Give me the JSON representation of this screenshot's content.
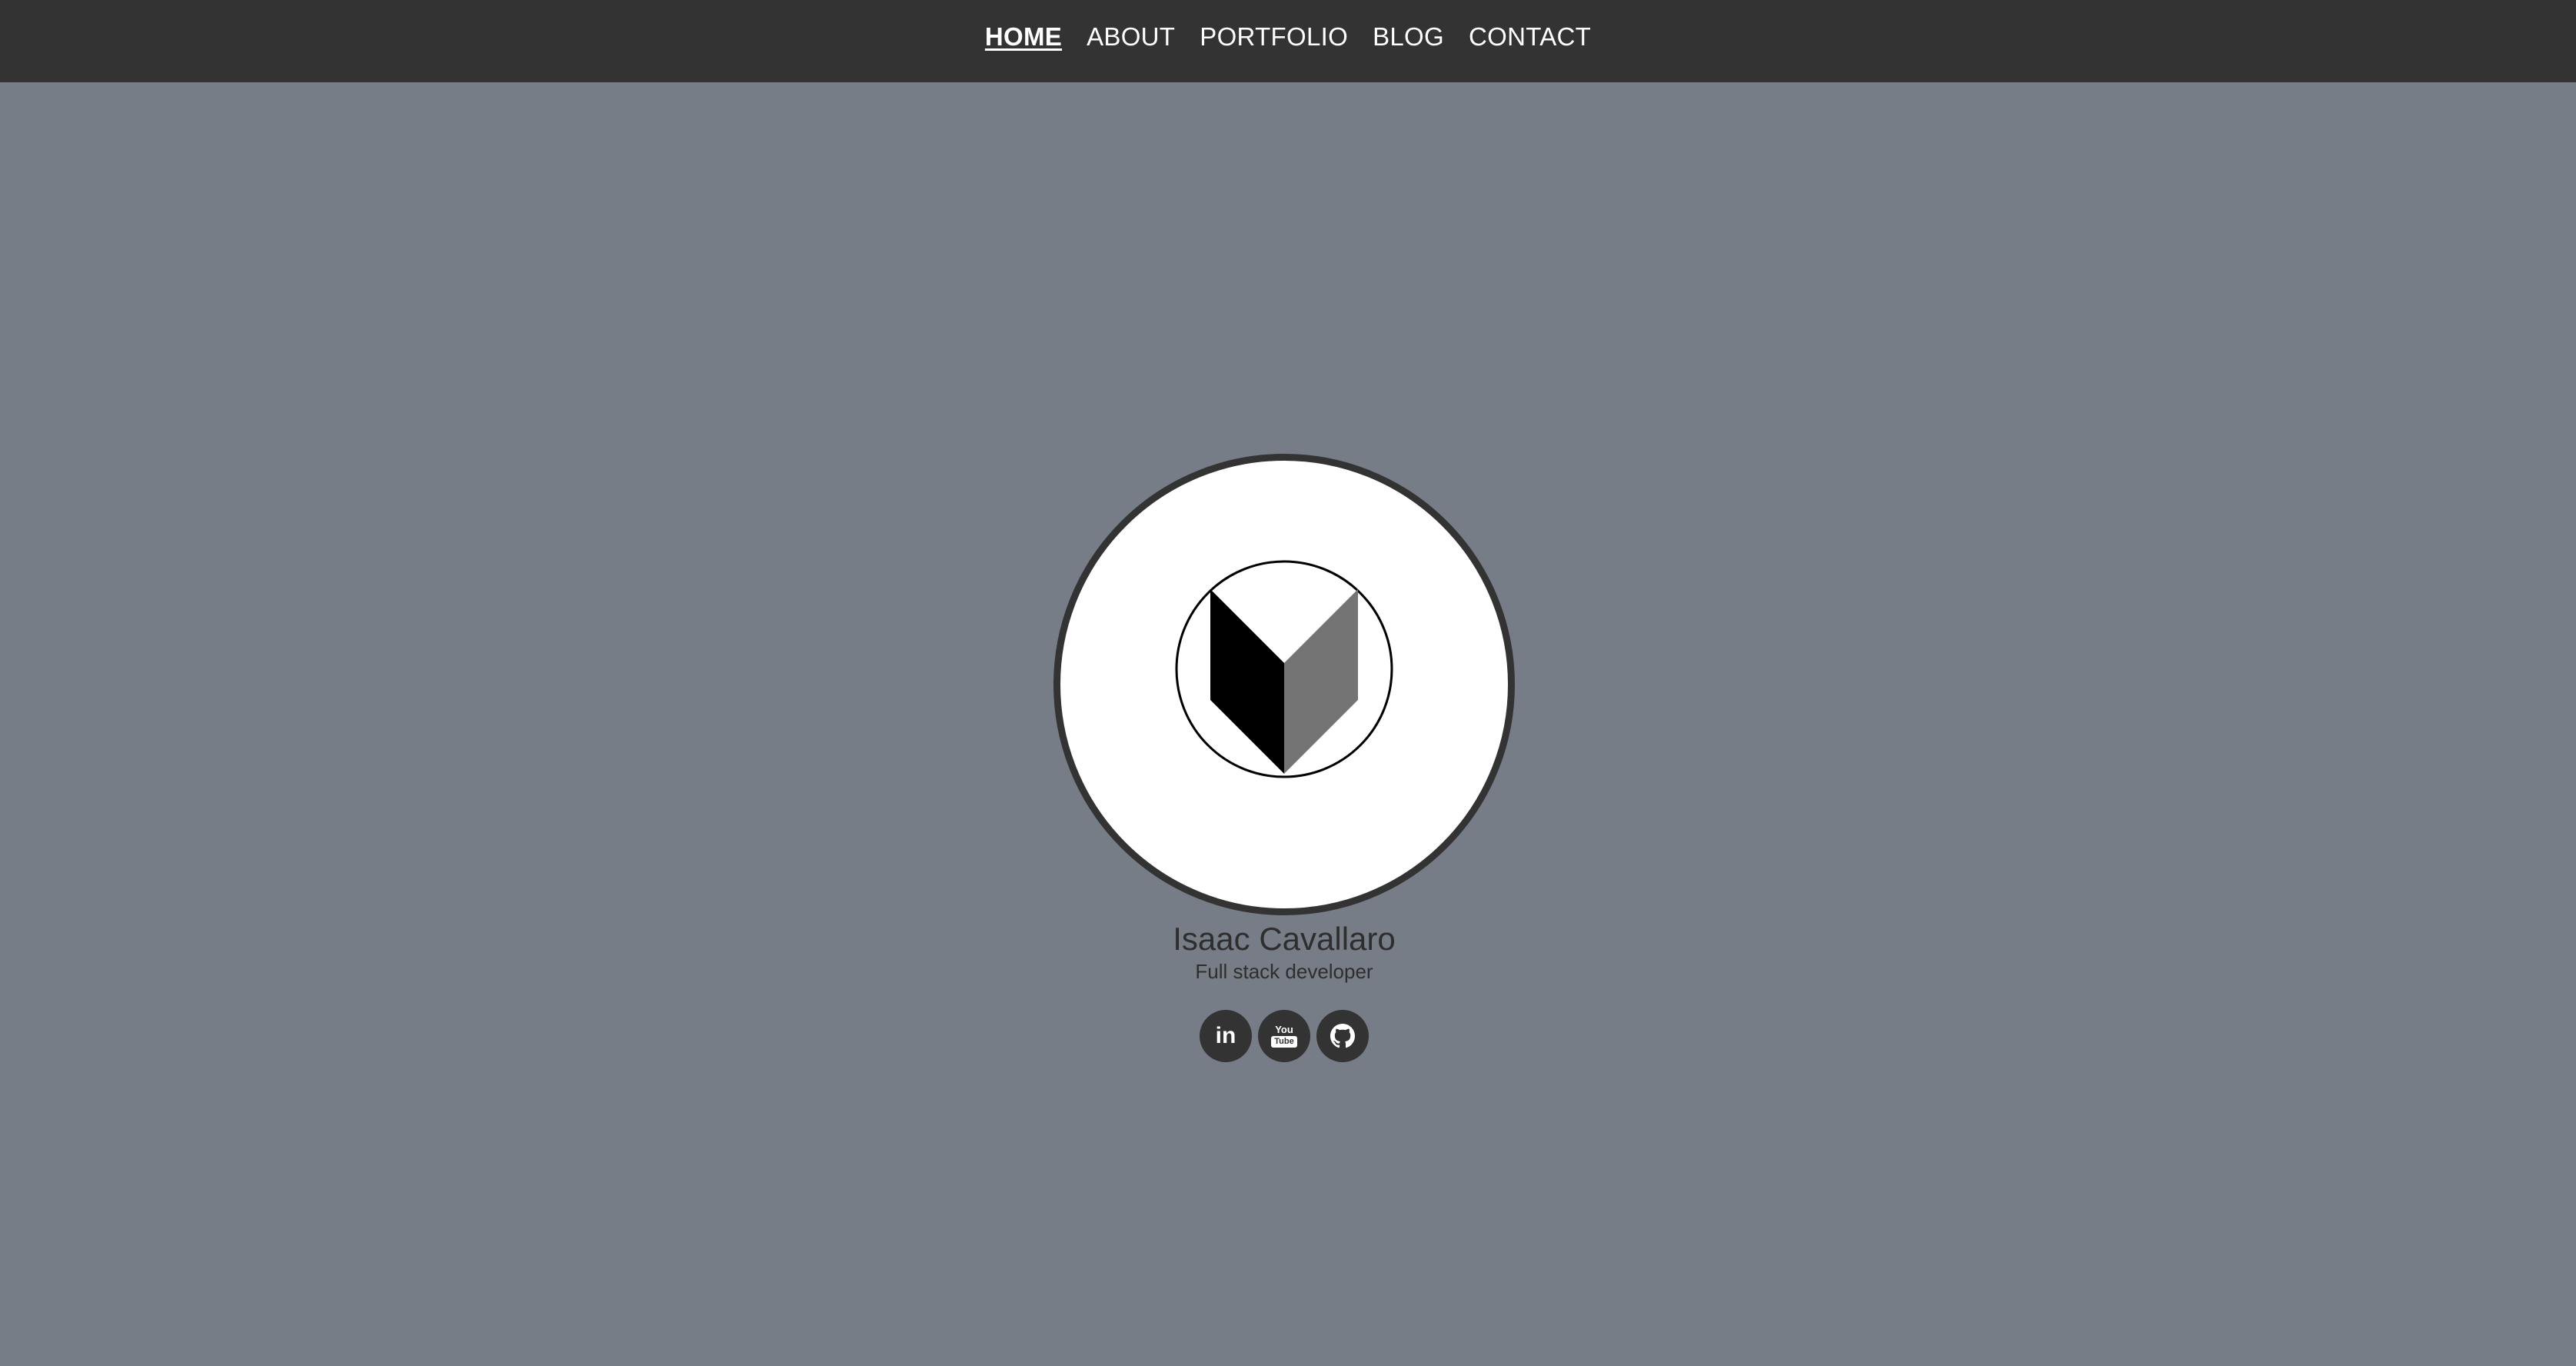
{
  "nav": {
    "items": [
      {
        "label": "HOME",
        "active": true
      },
      {
        "label": "ABOUT",
        "active": false
      },
      {
        "label": "PORTFOLIO",
        "active": false
      },
      {
        "label": "BLOG",
        "active": false
      },
      {
        "label": "CONTACT",
        "active": false
      }
    ]
  },
  "profile": {
    "name": "Isaac Cavallaro",
    "role": "Full stack developer",
    "logo_icon": "shield-logo"
  },
  "social": {
    "linkedin_label": "in",
    "youtube_you": "You",
    "youtube_tube": "Tube",
    "github_icon": "github-icon"
  },
  "colors": {
    "background": "#767d87",
    "nav_bar": "#333333",
    "avatar_bg": "#ffffff",
    "avatar_border": "#333333",
    "text_dark": "#2e2e2e"
  }
}
